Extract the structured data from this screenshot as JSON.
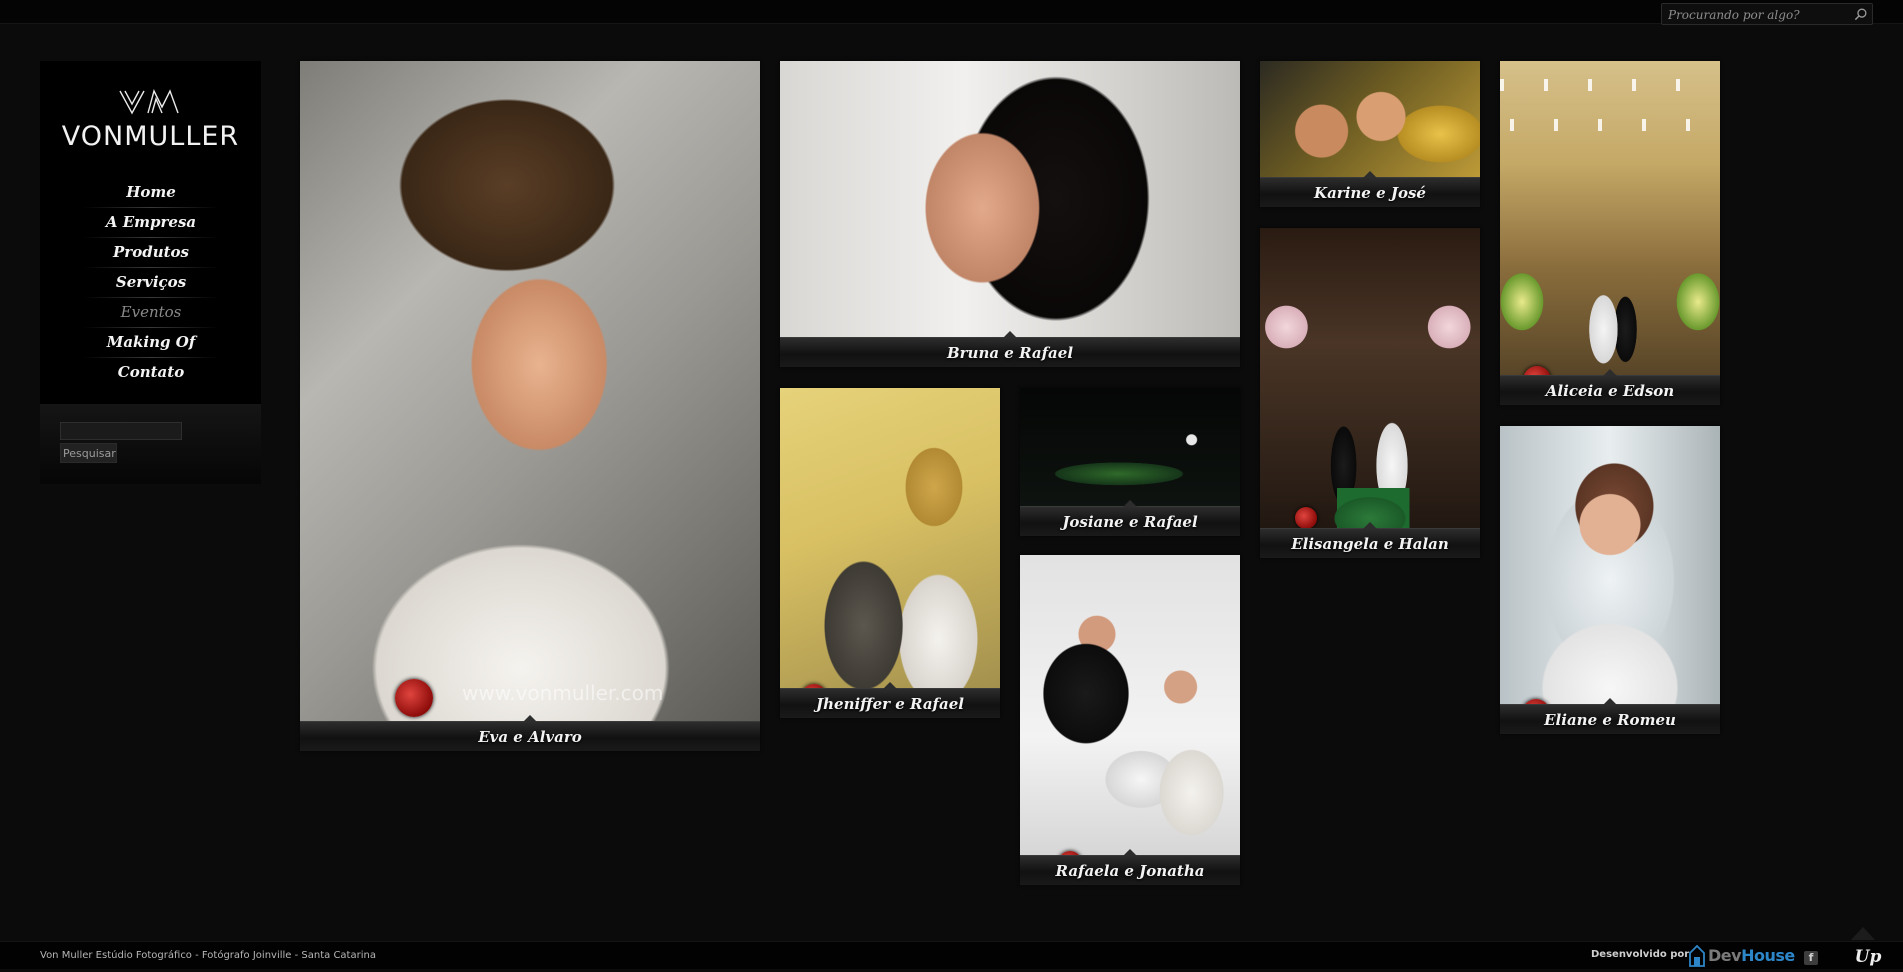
{
  "top_search": {
    "placeholder": "Procurando por algo?",
    "icon": "magnifier-icon"
  },
  "brand": {
    "logo_mark": "VM",
    "name": "VONMULLER"
  },
  "nav": [
    {
      "label": "Home",
      "active": false
    },
    {
      "label": "A Empresa",
      "active": false
    },
    {
      "label": "Produtos",
      "active": false
    },
    {
      "label": "Serviços",
      "active": false
    },
    {
      "label": "Eventos",
      "active": true
    },
    {
      "label": "Making Of",
      "active": false
    },
    {
      "label": "Contato",
      "active": false
    }
  ],
  "sidebar_search": {
    "value": "",
    "button": "Pesquisar"
  },
  "gallery": [
    {
      "caption": "Eva e Alvaro",
      "watermark": "www.vonmuller.com"
    },
    {
      "caption": "Bruna e Rafael"
    },
    {
      "caption": "Jheniffer e Rafael"
    },
    {
      "caption": "Josiane e Rafael"
    },
    {
      "caption": "Rafaela e Jonatha"
    },
    {
      "caption": "Karine e José"
    },
    {
      "caption": "Elisangela e Halan"
    },
    {
      "caption": "Aliceia e Edson"
    },
    {
      "caption": "Eliane e Romeu"
    }
  ],
  "footer": {
    "credit": "Von Muller Estúdio Fotográfico - Fotógrafo Joinville - Santa Catarina",
    "developed_by": "Desenvolvido por",
    "dev_logo_a": "Dev",
    "dev_logo_b": "House",
    "facebook": "f",
    "up": "Up"
  },
  "colors": {
    "background": "#0b0b0b",
    "sidebar": "#000000",
    "devhouse_blue": "#2d86c8",
    "stamp_red": "#c8201c"
  }
}
